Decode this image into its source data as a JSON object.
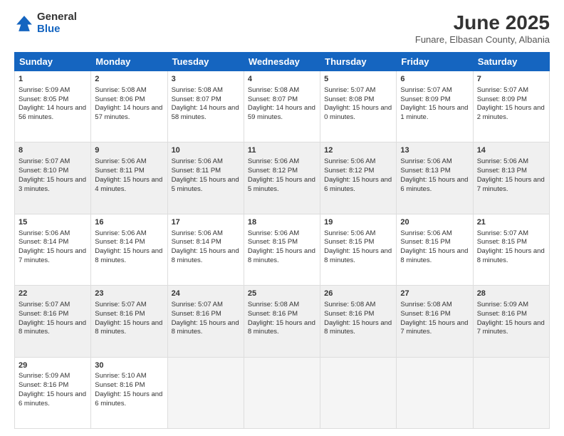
{
  "header": {
    "logo_line1": "General",
    "logo_line2": "Blue",
    "month": "June 2025",
    "location": "Funare, Elbasan County, Albania"
  },
  "weekdays": [
    "Sunday",
    "Monday",
    "Tuesday",
    "Wednesday",
    "Thursday",
    "Friday",
    "Saturday"
  ],
  "weeks": [
    [
      {
        "day": "1",
        "sunrise": "5:09 AM",
        "sunset": "8:05 PM",
        "daylight": "14 hours and 56 minutes."
      },
      {
        "day": "2",
        "sunrise": "5:08 AM",
        "sunset": "8:06 PM",
        "daylight": "14 hours and 57 minutes."
      },
      {
        "day": "3",
        "sunrise": "5:08 AM",
        "sunset": "8:07 PM",
        "daylight": "14 hours and 58 minutes."
      },
      {
        "day": "4",
        "sunrise": "5:08 AM",
        "sunset": "8:07 PM",
        "daylight": "14 hours and 59 minutes."
      },
      {
        "day": "5",
        "sunrise": "5:07 AM",
        "sunset": "8:08 PM",
        "daylight": "15 hours and 0 minutes."
      },
      {
        "day": "6",
        "sunrise": "5:07 AM",
        "sunset": "8:09 PM",
        "daylight": "15 hours and 1 minute."
      },
      {
        "day": "7",
        "sunrise": "5:07 AM",
        "sunset": "8:09 PM",
        "daylight": "15 hours and 2 minutes."
      }
    ],
    [
      {
        "day": "8",
        "sunrise": "5:07 AM",
        "sunset": "8:10 PM",
        "daylight": "15 hours and 3 minutes."
      },
      {
        "day": "9",
        "sunrise": "5:06 AM",
        "sunset": "8:11 PM",
        "daylight": "15 hours and 4 minutes."
      },
      {
        "day": "10",
        "sunrise": "5:06 AM",
        "sunset": "8:11 PM",
        "daylight": "15 hours and 5 minutes."
      },
      {
        "day": "11",
        "sunrise": "5:06 AM",
        "sunset": "8:12 PM",
        "daylight": "15 hours and 5 minutes."
      },
      {
        "day": "12",
        "sunrise": "5:06 AM",
        "sunset": "8:12 PM",
        "daylight": "15 hours and 6 minutes."
      },
      {
        "day": "13",
        "sunrise": "5:06 AM",
        "sunset": "8:13 PM",
        "daylight": "15 hours and 6 minutes."
      },
      {
        "day": "14",
        "sunrise": "5:06 AM",
        "sunset": "8:13 PM",
        "daylight": "15 hours and 7 minutes."
      }
    ],
    [
      {
        "day": "15",
        "sunrise": "5:06 AM",
        "sunset": "8:14 PM",
        "daylight": "15 hours and 7 minutes."
      },
      {
        "day": "16",
        "sunrise": "5:06 AM",
        "sunset": "8:14 PM",
        "daylight": "15 hours and 8 minutes."
      },
      {
        "day": "17",
        "sunrise": "5:06 AM",
        "sunset": "8:14 PM",
        "daylight": "15 hours and 8 minutes."
      },
      {
        "day": "18",
        "sunrise": "5:06 AM",
        "sunset": "8:15 PM",
        "daylight": "15 hours and 8 minutes."
      },
      {
        "day": "19",
        "sunrise": "5:06 AM",
        "sunset": "8:15 PM",
        "daylight": "15 hours and 8 minutes."
      },
      {
        "day": "20",
        "sunrise": "5:06 AM",
        "sunset": "8:15 PM",
        "daylight": "15 hours and 8 minutes."
      },
      {
        "day": "21",
        "sunrise": "5:07 AM",
        "sunset": "8:15 PM",
        "daylight": "15 hours and 8 minutes."
      }
    ],
    [
      {
        "day": "22",
        "sunrise": "5:07 AM",
        "sunset": "8:16 PM",
        "daylight": "15 hours and 8 minutes."
      },
      {
        "day": "23",
        "sunrise": "5:07 AM",
        "sunset": "8:16 PM",
        "daylight": "15 hours and 8 minutes."
      },
      {
        "day": "24",
        "sunrise": "5:07 AM",
        "sunset": "8:16 PM",
        "daylight": "15 hours and 8 minutes."
      },
      {
        "day": "25",
        "sunrise": "5:08 AM",
        "sunset": "8:16 PM",
        "daylight": "15 hours and 8 minutes."
      },
      {
        "day": "26",
        "sunrise": "5:08 AM",
        "sunset": "8:16 PM",
        "daylight": "15 hours and 8 minutes."
      },
      {
        "day": "27",
        "sunrise": "5:08 AM",
        "sunset": "8:16 PM",
        "daylight": "15 hours and 7 minutes."
      },
      {
        "day": "28",
        "sunrise": "5:09 AM",
        "sunset": "8:16 PM",
        "daylight": "15 hours and 7 minutes."
      }
    ],
    [
      {
        "day": "29",
        "sunrise": "5:09 AM",
        "sunset": "8:16 PM",
        "daylight": "15 hours and 6 minutes."
      },
      {
        "day": "30",
        "sunrise": "5:10 AM",
        "sunset": "8:16 PM",
        "daylight": "15 hours and 6 minutes."
      },
      null,
      null,
      null,
      null,
      null
    ]
  ]
}
